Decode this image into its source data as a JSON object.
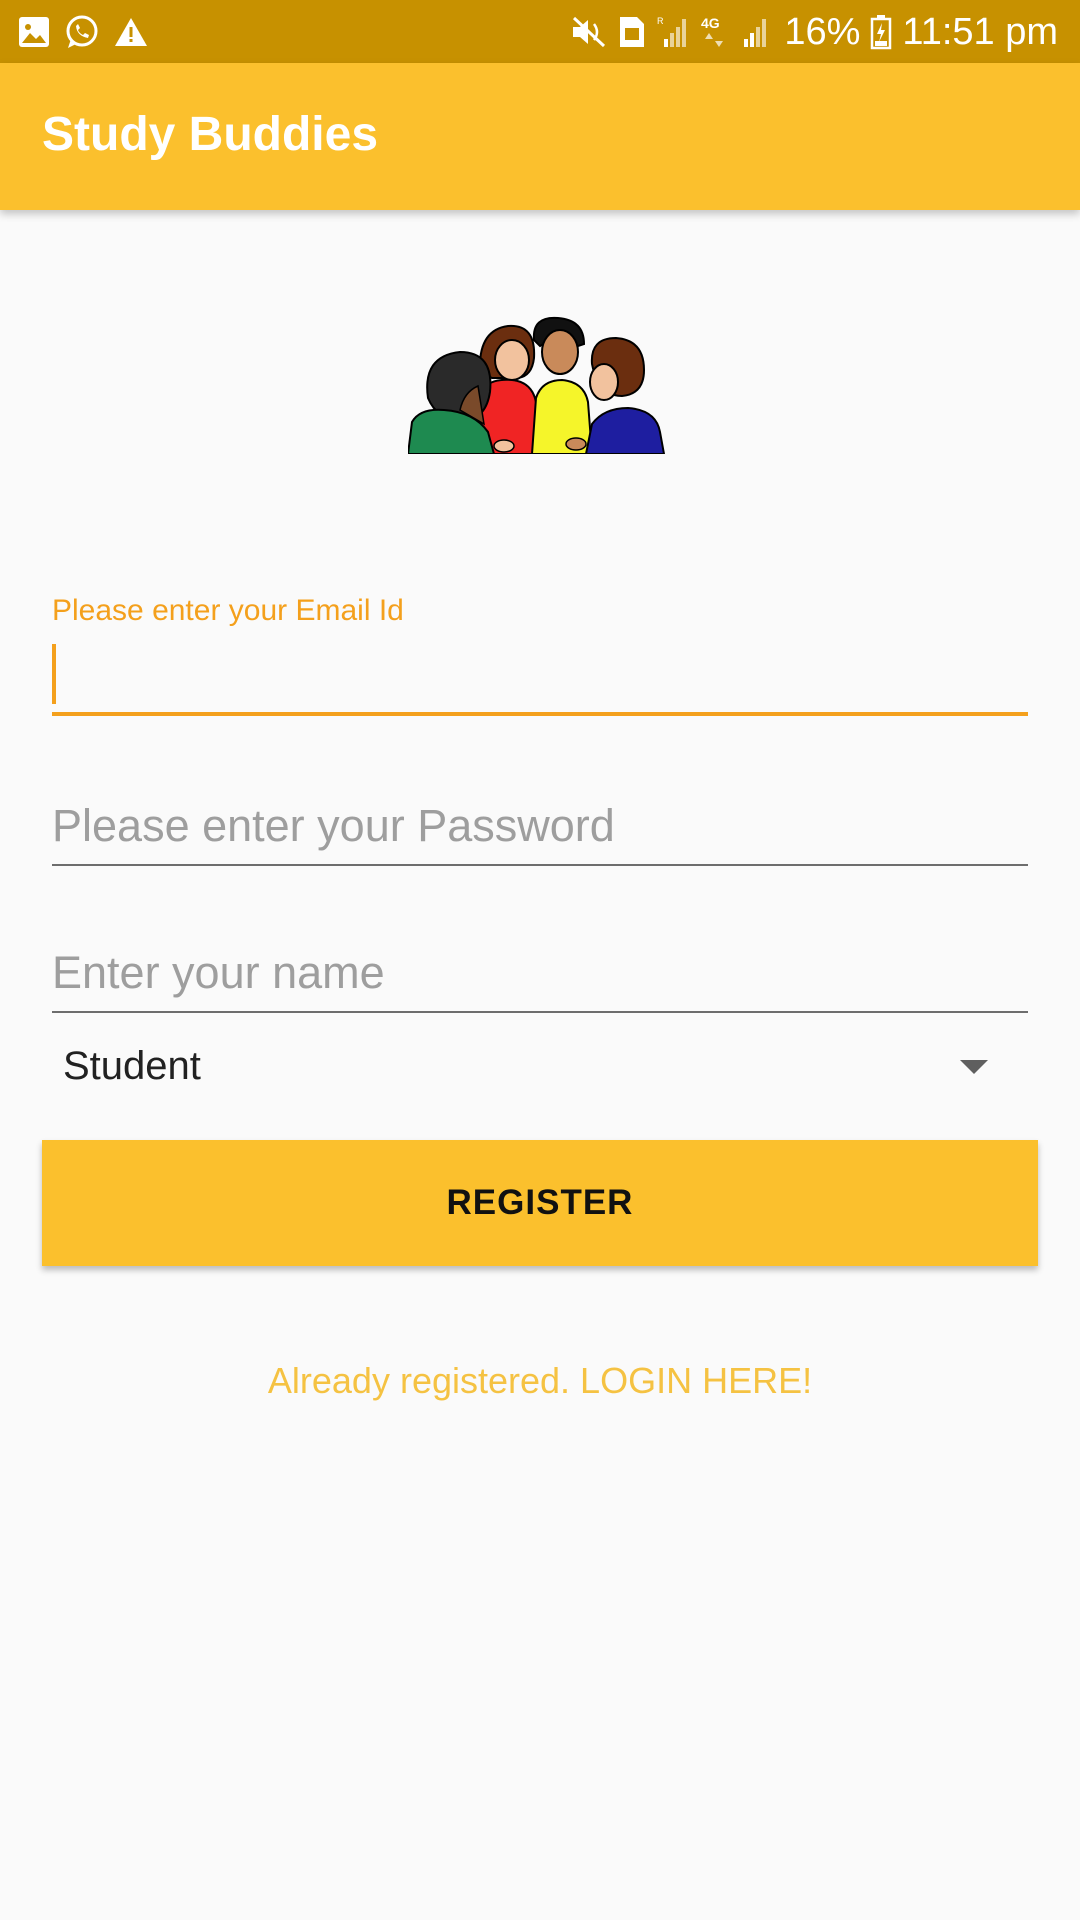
{
  "status_bar": {
    "battery_text": "16%",
    "time_text": "11:51 pm",
    "icons_left": [
      "gallery-icon",
      "whatsapp-icon",
      "warning-icon"
    ],
    "icons_right": [
      "mute-icon",
      "sim-icon",
      "signal-icon",
      "network-4g-icon",
      "signal-icon",
      "battery-icon"
    ]
  },
  "app_bar": {
    "title": "Study Buddies",
    "color": "#fbc02d"
  },
  "form": {
    "email": {
      "label": "Please enter your Email Id",
      "value": ""
    },
    "password": {
      "placeholder": "Please enter your Password",
      "value": ""
    },
    "name": {
      "placeholder": "Enter your name",
      "value": ""
    },
    "role_select": {
      "selected": "Student"
    }
  },
  "register_button": {
    "label": "REGISTER"
  },
  "login_link": {
    "text": "Already registered. LOGIN HERE!"
  },
  "colors": {
    "status_bar": "#c79100",
    "primary": "#fbc02d",
    "accent": "#f4a01c",
    "link": "#f5c242",
    "background": "#fafafa"
  }
}
